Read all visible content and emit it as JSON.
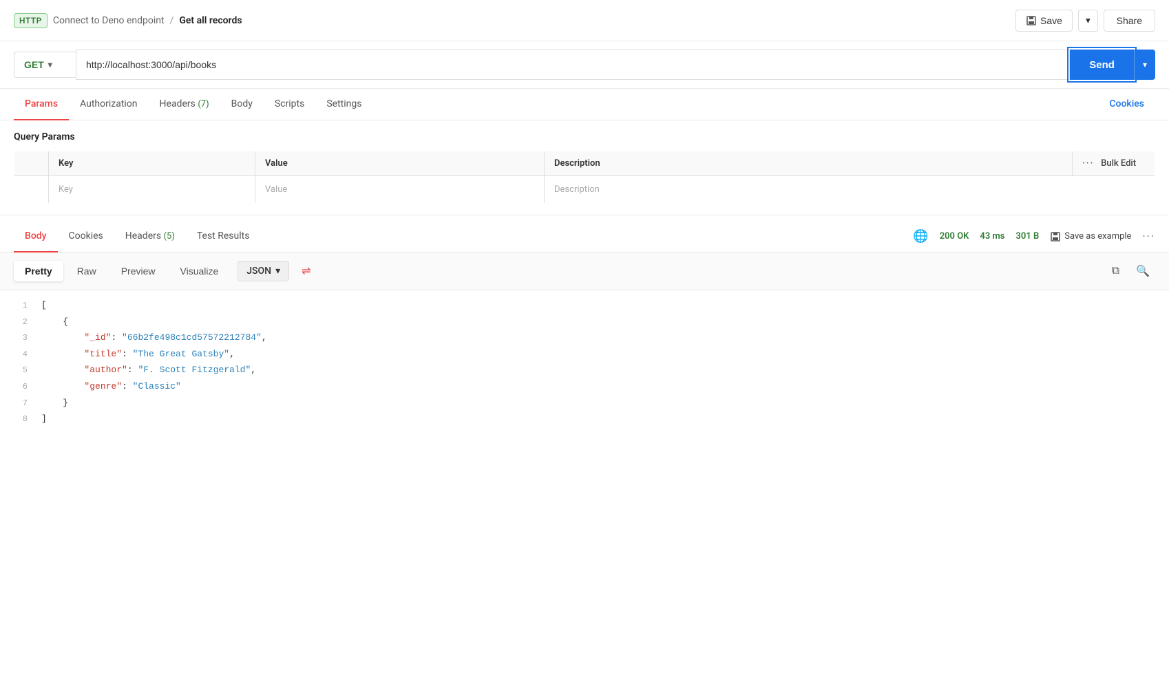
{
  "header": {
    "http_badge": "HTTP",
    "breadcrumb_parent": "Connect to Deno endpoint",
    "breadcrumb_separator": "/",
    "breadcrumb_current": "Get all records",
    "save_label": "Save",
    "share_label": "Share"
  },
  "url_bar": {
    "method": "GET",
    "url": "http://localhost:3000/api/books",
    "send_label": "Send"
  },
  "request_tabs": {
    "items": [
      {
        "id": "params",
        "label": "Params",
        "badge": null,
        "active": true
      },
      {
        "id": "authorization",
        "label": "Authorization",
        "badge": null,
        "active": false
      },
      {
        "id": "headers",
        "label": "Headers",
        "badge": "7",
        "active": false
      },
      {
        "id": "body",
        "label": "Body",
        "badge": null,
        "active": false
      },
      {
        "id": "scripts",
        "label": "Scripts",
        "badge": null,
        "active": false
      },
      {
        "id": "settings",
        "label": "Settings",
        "badge": null,
        "active": false
      }
    ],
    "cookies_label": "Cookies"
  },
  "query_params": {
    "title": "Query Params",
    "columns": {
      "key": "Key",
      "value": "Value",
      "description": "Description",
      "bulk_edit": "Bulk Edit"
    },
    "placeholder_row": {
      "key": "Key",
      "value": "Value",
      "description": "Description"
    }
  },
  "response_tabs": {
    "items": [
      {
        "id": "body",
        "label": "Body",
        "badge": null,
        "active": true
      },
      {
        "id": "cookies",
        "label": "Cookies",
        "badge": null,
        "active": false
      },
      {
        "id": "headers",
        "label": "Headers",
        "badge": "5",
        "active": false
      },
      {
        "id": "test_results",
        "label": "Test Results",
        "badge": null,
        "active": false
      }
    ],
    "status": {
      "globe_icon": "🌐",
      "status_code": "200 OK",
      "time": "43 ms",
      "size": "301 B"
    },
    "save_example_label": "Save as example"
  },
  "format_bar": {
    "views": [
      {
        "id": "pretty",
        "label": "Pretty",
        "active": true
      },
      {
        "id": "raw",
        "label": "Raw",
        "active": false
      },
      {
        "id": "preview",
        "label": "Preview",
        "active": false
      },
      {
        "id": "visualize",
        "label": "Visualize",
        "active": false
      }
    ],
    "format": "JSON"
  },
  "response_body": {
    "lines": [
      {
        "num": "1",
        "content": "[",
        "type": "bracket"
      },
      {
        "num": "2",
        "content": "    {",
        "type": "bracket"
      },
      {
        "num": "3",
        "key": "\"_id\"",
        "value": "\"66b2fe498c1cd57572212784\"",
        "suffix": ","
      },
      {
        "num": "4",
        "key": "\"title\"",
        "value": "\"The Great Gatsby\"",
        "suffix": ","
      },
      {
        "num": "5",
        "key": "\"author\"",
        "value": "\"F. Scott Fitzgerald\"",
        "suffix": ","
      },
      {
        "num": "6",
        "key": "\"genre\"",
        "value": "\"Classic\"",
        "suffix": ""
      },
      {
        "num": "7",
        "content": "    }",
        "type": "bracket"
      },
      {
        "num": "8",
        "content": "]",
        "type": "bracket"
      }
    ]
  }
}
